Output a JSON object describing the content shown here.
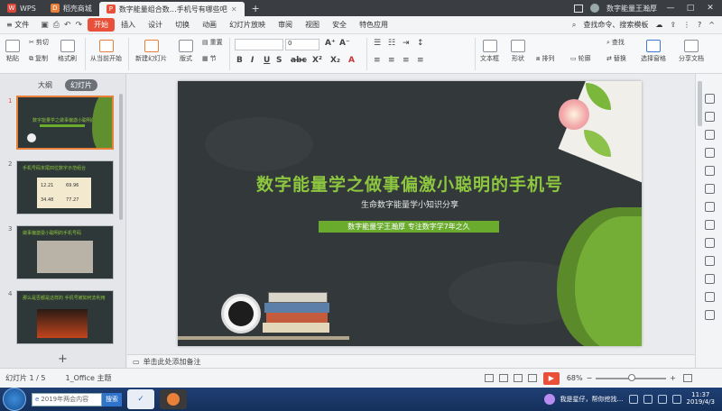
{
  "titlebar": {
    "tabs": [
      {
        "label": "WPS",
        "active": false
      },
      {
        "label": "稻壳商城",
        "active": false
      },
      {
        "label": "数字能量组合数…手机号有哪些吧",
        "active": true
      }
    ],
    "add_tab": "+",
    "account_name": "数字能量王瀚厚",
    "window_controls": [
      "—",
      "□",
      "✕"
    ]
  },
  "menubar": {
    "file_label": "文件",
    "items": [
      "开始",
      "插入",
      "设计",
      "切换",
      "动画",
      "幻灯片放映",
      "审阅",
      "视图",
      "安全",
      "特色应用"
    ],
    "active_item": "开始",
    "search_label": "查找命令、搜索模板",
    "right_icons": [
      "cloud-icon",
      "share-icon",
      "more-icon",
      "help-icon",
      "collapse-icon"
    ]
  },
  "ribbon": {
    "paste": "粘贴",
    "cut": "剪切",
    "copy": "复制",
    "format_painter": "格式刷",
    "from_current": "从当前开始",
    "new_slide": "新建幻灯片",
    "layout": "版式",
    "reset": "重置",
    "section": "节",
    "font_size": "0",
    "textbox": "文本框",
    "shape": "形状",
    "arrange": "排列",
    "outline": "轮廓",
    "find": "查找",
    "replace": "替换",
    "select_pane": "选择窗格",
    "share_doc": "分享文档"
  },
  "leftpanel": {
    "tabs": [
      "大纲",
      "幻灯片"
    ],
    "active_tab": "幻灯片",
    "thumbs": [
      {
        "num": "1",
        "text": "数字能量学之做事偏激小聪明的手机号"
      },
      {
        "num": "2",
        "text": "手机号码末尾四位数字示范组合"
      },
      {
        "num": "3",
        "text": "做事偏激耍小聪明的手机号码"
      },
      {
        "num": "4",
        "text": "那么是否都是这样的 手机号被如何去利用"
      }
    ],
    "thumb2_values": [
      "12.21",
      "69.96",
      "34.48",
      "77.27"
    ],
    "add_slide": "+"
  },
  "slide": {
    "title": "数字能量学之做事偏激小聪明的手机号",
    "subtitle": "生命数字能量学小知识分享",
    "bar_text": "数字能量学王瀚厚  专注数字学7年之久",
    "accent_green": "#8dc63f",
    "bar_green": "#6aab2e",
    "board_color": "#33393a"
  },
  "notes": {
    "placeholder": "单击此处添加备注"
  },
  "statusbar": {
    "slide_info": "幻灯片 1 / 5",
    "theme": "1_Office 主题",
    "zoom": "68%",
    "zoom_fraction": 0.5,
    "zoom_minus": "−",
    "zoom_plus": "+"
  },
  "taskbar": {
    "search_text": "2019年两会内容",
    "search_button": "搜索",
    "notice": "我是星仔，帮你挖找…",
    "time": "11:37",
    "date": "2019/4/3"
  }
}
